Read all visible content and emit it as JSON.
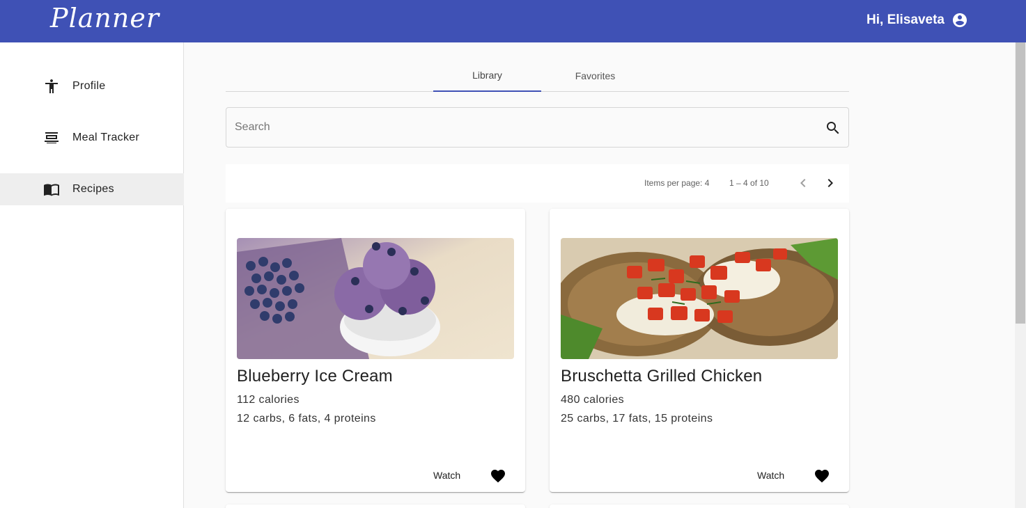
{
  "header": {
    "logo_text": "Planner",
    "greeting": "Hi, Elisaveta",
    "avatar_icon": "account-circle-icon",
    "background_color": "#3f51b5"
  },
  "sidebar": {
    "items": [
      {
        "label": "Profile",
        "icon": "accessibility-icon",
        "active": false
      },
      {
        "label": "Meal Tracker",
        "icon": "meal-tray-icon",
        "active": false
      },
      {
        "label": "Recipes",
        "icon": "menu-book-icon",
        "active": true
      }
    ]
  },
  "tabs": [
    {
      "label": "Library",
      "active": true
    },
    {
      "label": "Favorites",
      "active": false
    }
  ],
  "search": {
    "placeholder": "Search",
    "value": "",
    "icon": "search-icon"
  },
  "paginator": {
    "items_per_page": "Items per page: 4",
    "range": "1 – 4 of 10",
    "prev_icon": "chevron-left-icon",
    "next_icon": "chevron-right-icon"
  },
  "recipes": [
    {
      "title": "Blueberry Ice Cream",
      "calories": "112 calories",
      "macros": "12 carbs, 6 fats, 4 proteins",
      "watch_label": "Watch",
      "favorite_icon": "heart-icon"
    },
    {
      "title": "Bruschetta Grilled Chicken",
      "calories": "480 calories",
      "macros": "25 carbs, 17 fats, 15 proteins",
      "watch_label": "Watch",
      "favorite_icon": "heart-icon"
    }
  ]
}
